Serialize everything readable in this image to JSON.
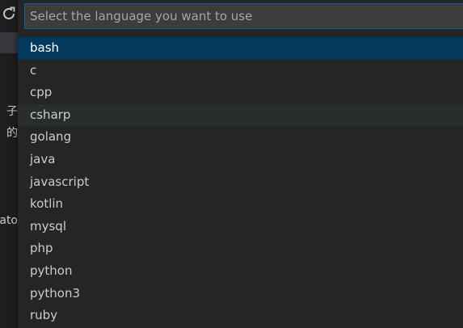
{
  "background": {
    "side_text": [
      "子",
      "的",
      "ato"
    ]
  },
  "quick_pick": {
    "placeholder": "Select the language you want to use",
    "items": [
      {
        "label": "bash",
        "state": "selected"
      },
      {
        "label": "c",
        "state": ""
      },
      {
        "label": "cpp",
        "state": ""
      },
      {
        "label": "csharp",
        "state": "hover"
      },
      {
        "label": "golang",
        "state": ""
      },
      {
        "label": "java",
        "state": ""
      },
      {
        "label": "javascript",
        "state": ""
      },
      {
        "label": "kotlin",
        "state": ""
      },
      {
        "label": "mysql",
        "state": ""
      },
      {
        "label": "php",
        "state": ""
      },
      {
        "label": "python",
        "state": ""
      },
      {
        "label": "python3",
        "state": ""
      },
      {
        "label": "ruby",
        "state": ""
      }
    ]
  },
  "colors": {
    "selected_bg": "#04395e",
    "hover_bg": "#2a2d2e",
    "panel_bg": "#252526",
    "input_border": "#0e639c"
  },
  "icons": {
    "refresh": "refresh-icon"
  }
}
